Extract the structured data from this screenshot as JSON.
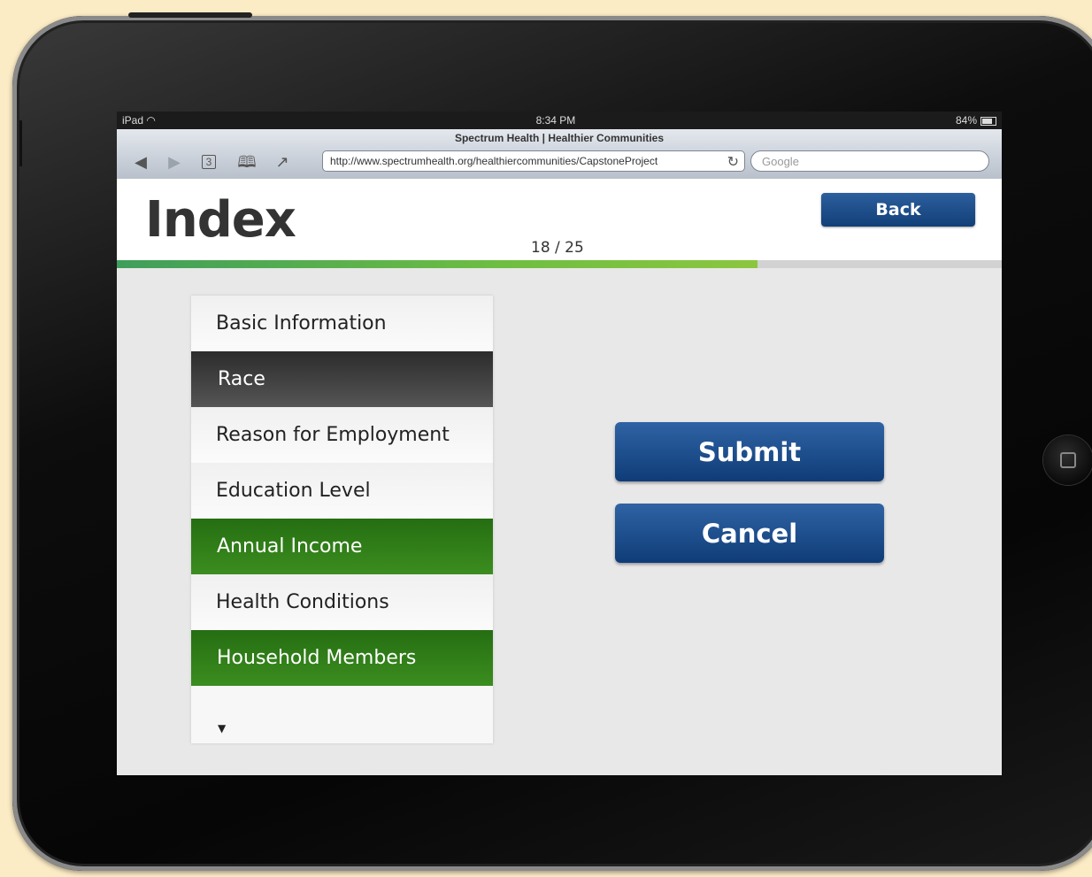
{
  "statusbar": {
    "device": "iPad",
    "wifi_icon": "wifi-icon",
    "time": "8:34 PM",
    "battery": "84%"
  },
  "browser": {
    "page_title": "Spectrum Health | Healthier Communities",
    "url": "http://www.spectrumhealth.org/healthiercommunities/CapstoneProject",
    "search_placeholder": "Google",
    "tab_count": "3"
  },
  "header": {
    "title": "Index",
    "back_label": "Back",
    "page_counter": "18 / 25",
    "progress": 0.724
  },
  "index": {
    "items": [
      {
        "label": "Basic Information",
        "state": "default"
      },
      {
        "label": "Race",
        "state": "selected"
      },
      {
        "label": "Reason for Employment",
        "state": "default"
      },
      {
        "label": "Education Level",
        "state": "default"
      },
      {
        "label": "Annual Income",
        "state": "completed"
      },
      {
        "label": "Health Conditions",
        "state": "default"
      },
      {
        "label": "Household Members",
        "state": "completed"
      }
    ],
    "more_icon": "▼"
  },
  "actions": {
    "submit_label": "Submit",
    "cancel_label": "Cancel"
  },
  "colors": {
    "accent_blue": "#1a4a8a",
    "completed_green": "#2f7d18",
    "selected_dark": "#3a3a3a",
    "progress_green": "#6ebe42"
  }
}
